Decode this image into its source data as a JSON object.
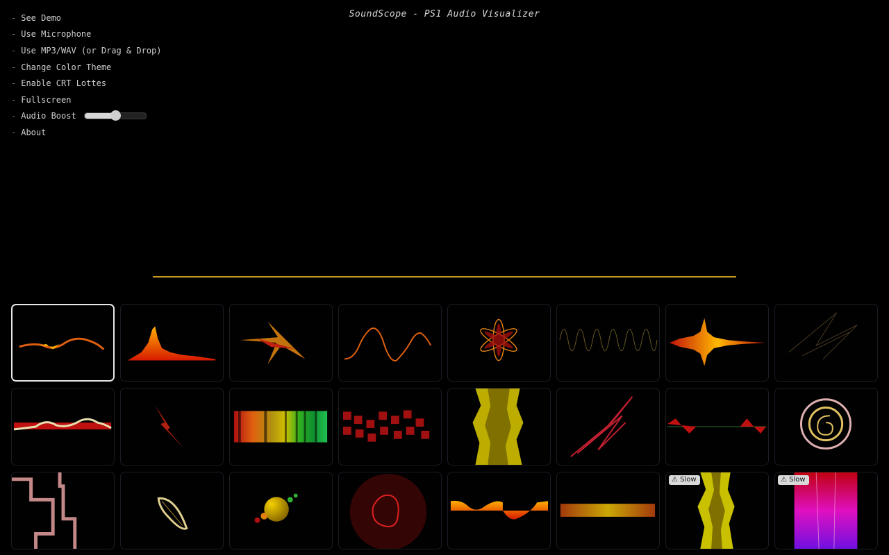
{
  "app": {
    "title": "SoundScope - PS1 Audio Visualizer"
  },
  "menu": {
    "dash": "-",
    "items": [
      {
        "label": "See Demo"
      },
      {
        "label": "Use Microphone"
      },
      {
        "label": "Use MP3/WAV (or Drag & Drop)"
      },
      {
        "label": "Change Color Theme"
      },
      {
        "label": "Enable CRT Lottes"
      },
      {
        "label": "Fullscreen"
      },
      {
        "label": "Audio Boost"
      },
      {
        "label": "About"
      }
    ],
    "audio_boost_level": 0.5
  },
  "colors": {
    "accent_wave": "#c49a24",
    "tile_border": "#1b1c24",
    "selected_border": "#e8e8e8"
  },
  "tiles": [
    {
      "id": "vis-1",
      "selected": true
    },
    {
      "id": "vis-2"
    },
    {
      "id": "vis-3"
    },
    {
      "id": "vis-4"
    },
    {
      "id": "vis-5"
    },
    {
      "id": "vis-6"
    },
    {
      "id": "vis-7"
    },
    {
      "id": "vis-8"
    },
    {
      "id": "vis-9"
    },
    {
      "id": "vis-10"
    },
    {
      "id": "vis-11"
    },
    {
      "id": "vis-12"
    },
    {
      "id": "vis-13"
    },
    {
      "id": "vis-14"
    },
    {
      "id": "vis-15"
    },
    {
      "id": "vis-16"
    },
    {
      "id": "vis-17"
    },
    {
      "id": "vis-18"
    },
    {
      "id": "vis-19"
    },
    {
      "id": "vis-20"
    },
    {
      "id": "vis-21"
    },
    {
      "id": "vis-22"
    },
    {
      "id": "vis-23",
      "badge": "Slow",
      "badge_icon": "warning-icon"
    },
    {
      "id": "vis-24",
      "badge": "Slow",
      "badge_icon": "warning-icon"
    }
  ]
}
